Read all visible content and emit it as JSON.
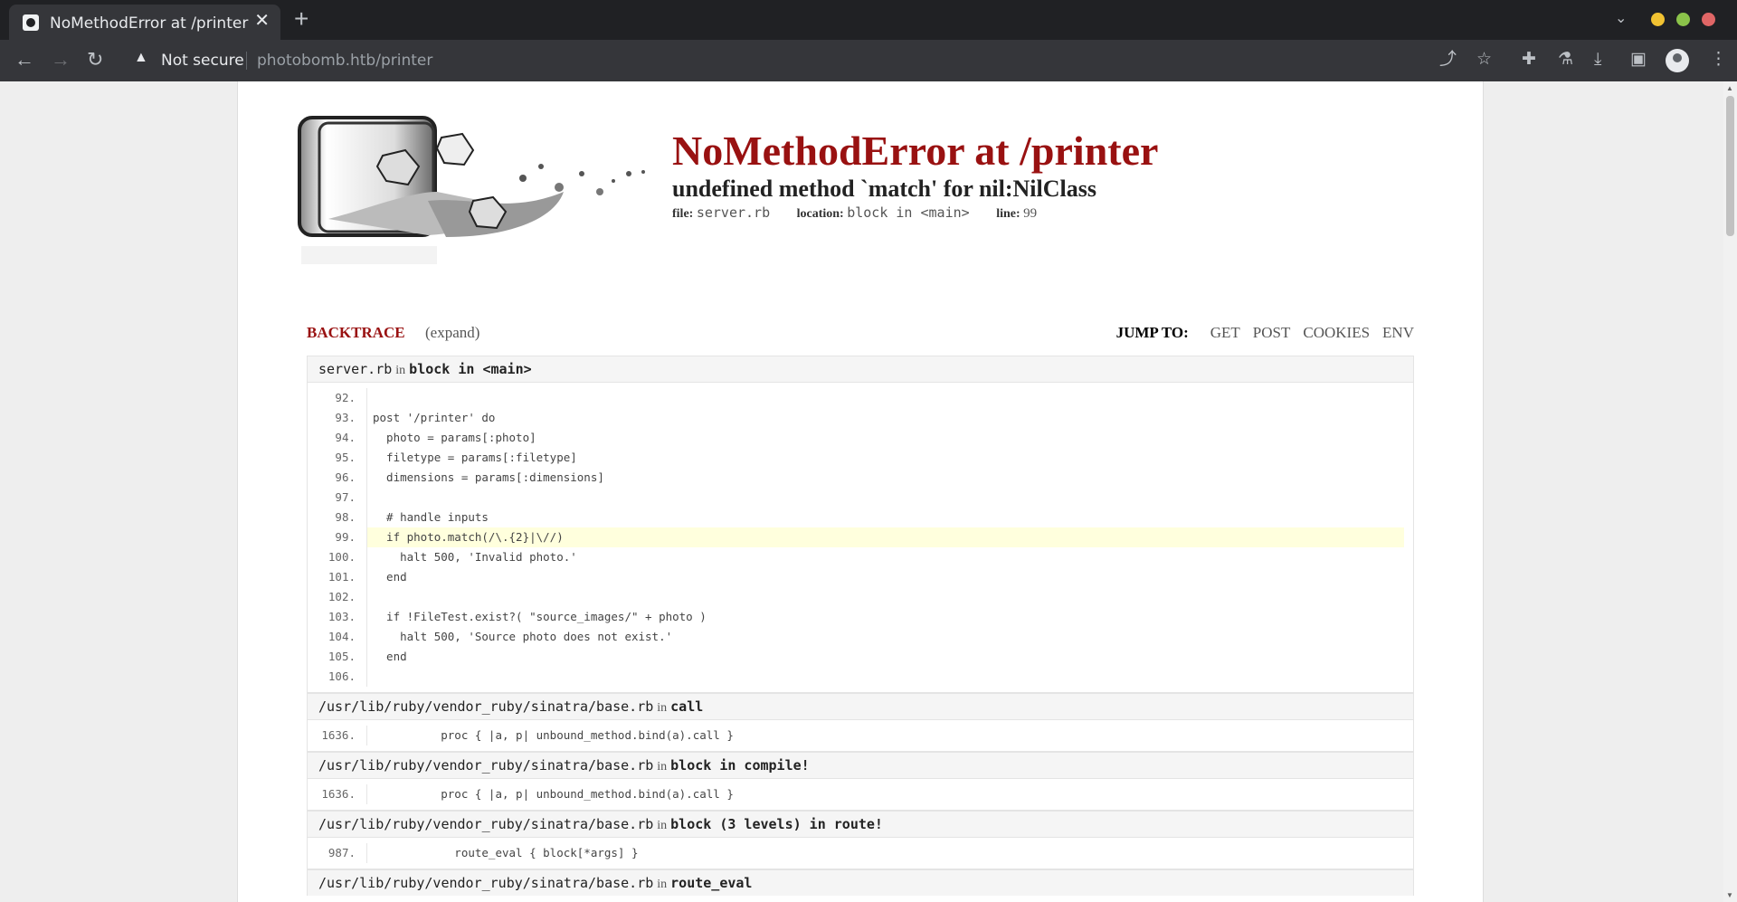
{
  "browser": {
    "tab_title": "NoMethodError at /printer",
    "tab_close": "✕",
    "new_tab": "+",
    "not_secure": "Not secure",
    "url_host": "photobomb.htb",
    "url_path": "/printer",
    "window_dots": [
      "#f1c232",
      "#8bc34a",
      "#e06666"
    ]
  },
  "error": {
    "title": "NoMethodError at /printer",
    "message": "undefined method `match' for nil:NilClass",
    "file_label": "file:",
    "file_value": "server.rb",
    "location_label": "location:",
    "location_value": "block in <main>",
    "line_label": "line:",
    "line_value": "99"
  },
  "backtrace": {
    "title": "BACKTRACE",
    "expand": "(expand)",
    "jump_label": "JUMP TO:",
    "jump_links": [
      "GET",
      "POST",
      "COOKIES",
      "ENV"
    ]
  },
  "frames": [
    {
      "file": "server.rb",
      "in": "in",
      "context": "block in <main>",
      "highlight_line": "99.",
      "lines": [
        {
          "no": "92.",
          "code": ""
        },
        {
          "no": "93.",
          "code": "post '/printer' do"
        },
        {
          "no": "94.",
          "code": "  photo = params[:photo]"
        },
        {
          "no": "95.",
          "code": "  filetype = params[:filetype]"
        },
        {
          "no": "96.",
          "code": "  dimensions = params[:dimensions]"
        },
        {
          "no": "97.",
          "code": ""
        },
        {
          "no": "98.",
          "code": "  # handle inputs"
        },
        {
          "no": "99.",
          "code": "  if photo.match(/\\.{2}|\\//)"
        },
        {
          "no": "100.",
          "code": "    halt 500, 'Invalid photo.'"
        },
        {
          "no": "101.",
          "code": "  end"
        },
        {
          "no": "102.",
          "code": ""
        },
        {
          "no": "103.",
          "code": "  if !FileTest.exist?( \"source_images/\" + photo )"
        },
        {
          "no": "104.",
          "code": "    halt 500, 'Source photo does not exist.'"
        },
        {
          "no": "105.",
          "code": "  end"
        },
        {
          "no": "106.",
          "code": ""
        }
      ]
    },
    {
      "file": "/usr/lib/ruby/vendor_ruby/sinatra/base.rb",
      "in": "in",
      "context": "call",
      "lines": [
        {
          "no": "1636.",
          "code": "          proc { |a, p| unbound_method.bind(a).call }"
        }
      ]
    },
    {
      "file": "/usr/lib/ruby/vendor_ruby/sinatra/base.rb",
      "in": "in",
      "context": "block in compile!",
      "lines": [
        {
          "no": "1636.",
          "code": "          proc { |a, p| unbound_method.bind(a).call }"
        }
      ]
    },
    {
      "file": "/usr/lib/ruby/vendor_ruby/sinatra/base.rb",
      "in": "in",
      "context": "block (3 levels) in route!",
      "lines": [
        {
          "no": "987.",
          "code": "            route_eval { block[*args] }"
        }
      ]
    },
    {
      "file": "/usr/lib/ruby/vendor_ruby/sinatra/base.rb",
      "in": "in",
      "context": "route_eval",
      "lines": []
    }
  ]
}
